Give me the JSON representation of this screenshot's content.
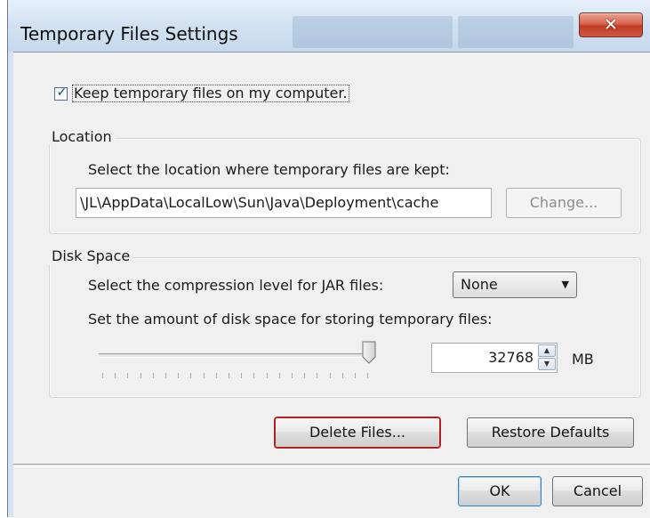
{
  "window": {
    "title": "Temporary Files Settings"
  },
  "keep_temp": {
    "label": "Keep temporary files on my computer.",
    "checked": true
  },
  "location": {
    "group_title": "Location",
    "description": "Select the location where temporary files are kept:",
    "path_value": "\\JL\\AppData\\LocalLow\\Sun\\Java\\Deployment\\cache",
    "change_button": "Change..."
  },
  "disk_space": {
    "group_title": "Disk Space",
    "compression_label": "Select the compression level for JAR files:",
    "compression_value": "None",
    "amount_label": "Set the amount of disk space for storing temporary files:",
    "slider_level": 1.0,
    "amount_value": "32768",
    "unit": "MB"
  },
  "buttons": {
    "delete_files": "Delete Files...",
    "restore_defaults": "Restore Defaults",
    "ok": "OK",
    "cancel": "Cancel"
  },
  "colors": {
    "close_button": "#c9452f",
    "focus_outline": "#b02020",
    "default_button_border": "#3c7fb1"
  }
}
